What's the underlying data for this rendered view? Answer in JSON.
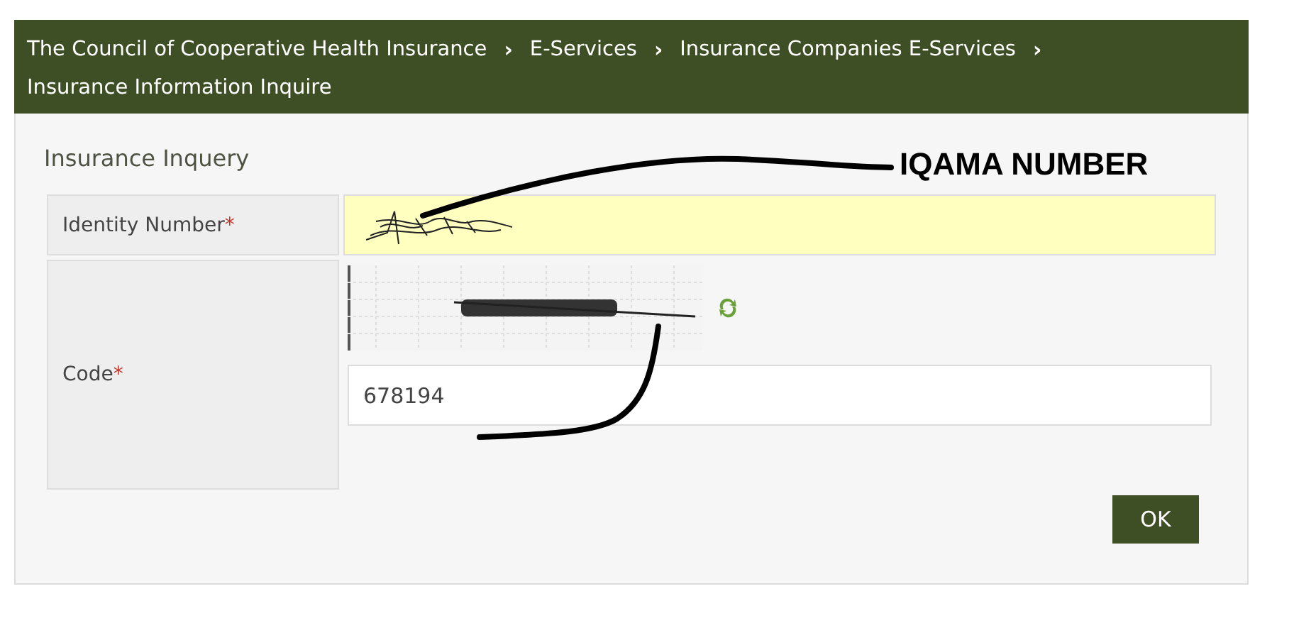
{
  "breadcrumb": [
    {
      "label": "The Council of Cooperative Health Insurance",
      "separator": "›"
    },
    {
      "label": "E-Services",
      "separator": "›"
    },
    {
      "label": "Insurance Companies E-Services",
      "separator": "›"
    },
    {
      "label": "Insurance Information Inquire"
    }
  ],
  "form": {
    "title": "Insurance Inquery",
    "identity": {
      "label": "Identity Number",
      "required_mark": "*"
    },
    "code": {
      "label": "Code",
      "required_mark": "*",
      "value": "678194"
    },
    "button": "OK"
  },
  "annotation": {
    "text": "IQAMA NUMBER"
  }
}
